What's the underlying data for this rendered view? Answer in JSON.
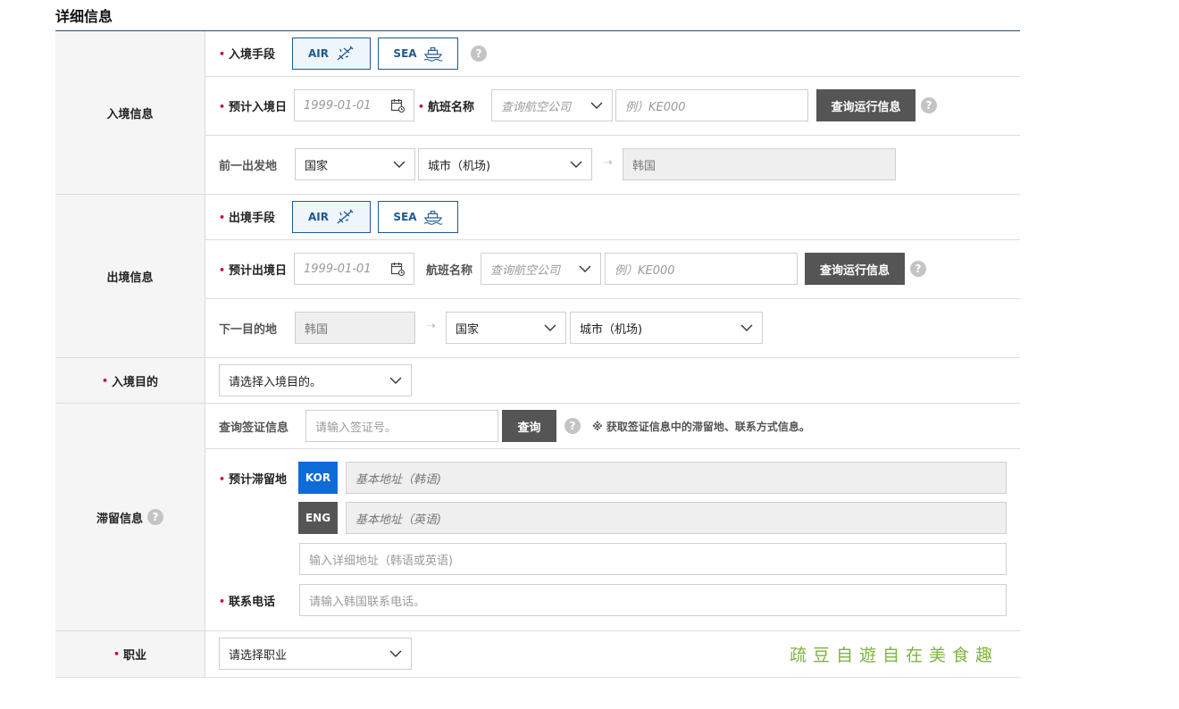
{
  "page": {
    "title": "详细信息"
  },
  "common": {
    "help": "?",
    "air": "AIR",
    "sea": "SEA",
    "arrow": "➝"
  },
  "entry": {
    "label": "入境信息",
    "mode_label": "入境手段",
    "date_label": "预计入境日",
    "date_placeholder": "1999-01-01",
    "flight_label": "航班名称",
    "airline_placeholder": "查询航空公司",
    "flight_placeholder": "例）KE000",
    "search_button": "查询运行信息",
    "origin_label": "前一出发地",
    "country": "国家",
    "city": "城市（机场)",
    "korea": "韩国"
  },
  "exit": {
    "label": "出境信息",
    "mode_label": "出境手段",
    "date_label": "预计出境日",
    "date_placeholder": "1999-01-01",
    "flight_label": "航班名称",
    "airline_placeholder": "查询航空公司",
    "flight_placeholder": "例）KE000",
    "search_button": "查询运行信息",
    "dest_label": "下一目的地",
    "korea": "韩国",
    "country": "国家",
    "city": "城市（机场)"
  },
  "purpose": {
    "label": "入境目的",
    "select": "请选择入境目的。"
  },
  "stay": {
    "label": "滞留信息",
    "visa_label": "查询签证信息",
    "visa_placeholder": "请输入签证号。",
    "visa_button": "查询",
    "visa_note": "※ 获取签证信息中的滞留地、联系方式信息。",
    "addr_label": "预计滞留地",
    "kor_tag": "KOR",
    "eng_tag": "ENG",
    "addr_kor_placeholder": "基本地址（韩语)",
    "addr_eng_placeholder": "基本地址（英语)",
    "addr_detail_placeholder": "输入详细地址（韩语或英语)",
    "phone_label": "联系电话",
    "phone_placeholder": "请输入韩国联系电话。"
  },
  "job": {
    "label": "职业",
    "select": "请选择职业"
  },
  "watermark": "疏豆自遊自在美食趣"
}
